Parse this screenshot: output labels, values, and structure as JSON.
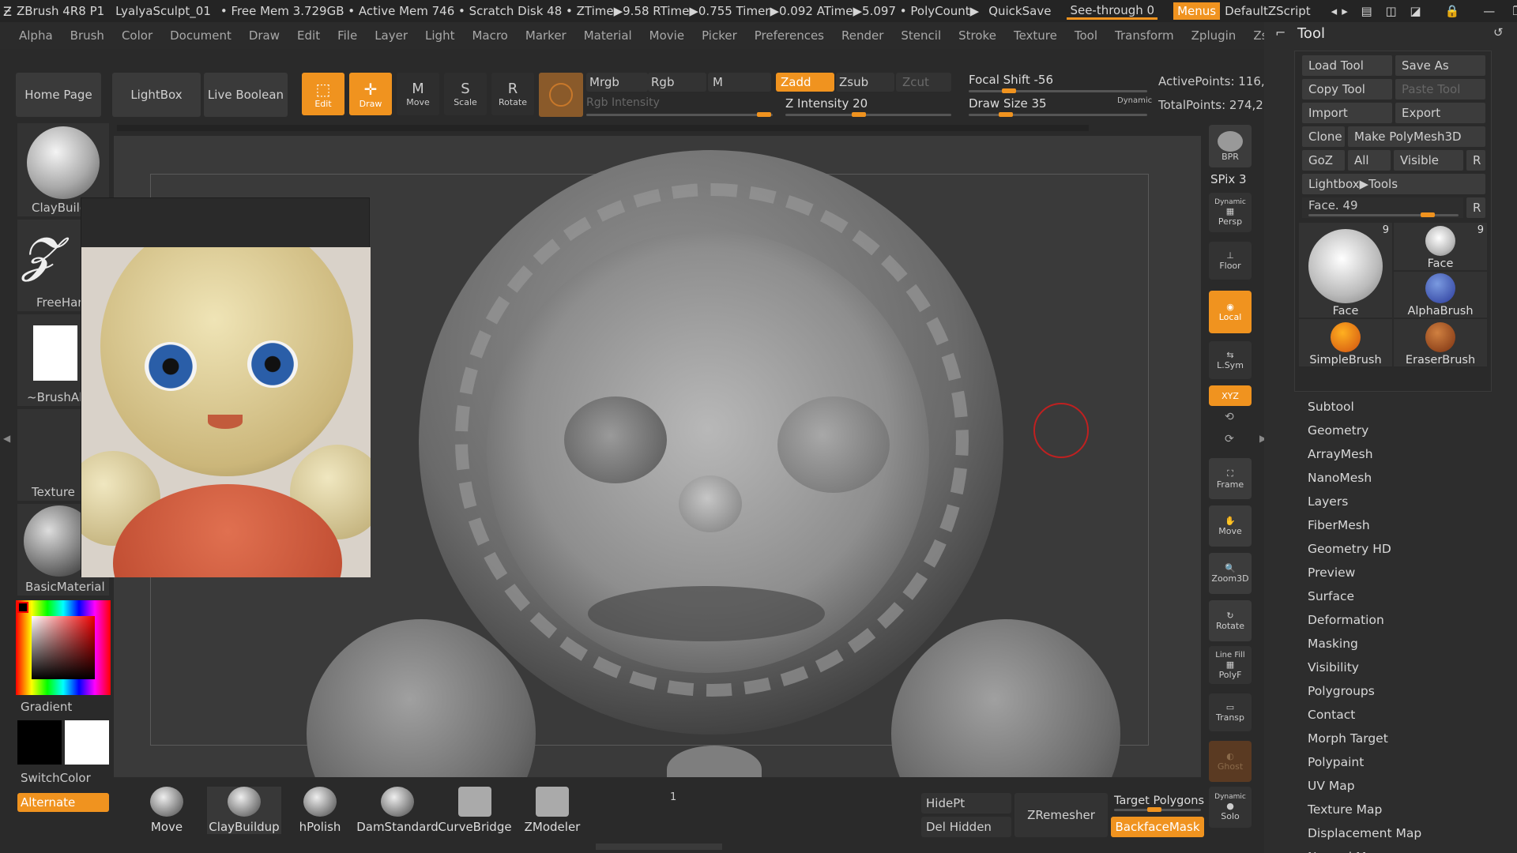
{
  "titlebar": {
    "app": "ZBrush 4R8 P1",
    "project": "LyalyaSculpt_01",
    "stats": "• Free Mem 3.729GB • Active Mem 746 • Scratch Disk 48 • ZTime▶9.58 RTime▶0.755 Timer▶0.092 ATime▶5.097 • PolyCount▶",
    "quicksave": "QuickSave",
    "seethrough": "See-through  0",
    "menus": "Menus",
    "zscript": "DefaultZScript"
  },
  "menus": [
    "Alpha",
    "Brush",
    "Color",
    "Document",
    "Draw",
    "Edit",
    "File",
    "Layer",
    "Light",
    "Macro",
    "Marker",
    "Material",
    "Movie",
    "Picker",
    "Preferences",
    "Render",
    "Stencil",
    "Stroke",
    "Texture",
    "Tool",
    "Transform",
    "Zplugin",
    "Zscript"
  ],
  "top": {
    "home": "Home Page",
    "lightbox": "LightBox",
    "liveboolean": "Live Boolean",
    "edit": "Edit",
    "draw": "Draw",
    "move": "Move",
    "scale": "Scale",
    "rotate": "Rotate",
    "mrgb": "Mrgb",
    "rgb": "Rgb",
    "m": "M",
    "zadd": "Zadd",
    "zsub": "Zsub",
    "zcut": "Zcut",
    "rgb_intensity": "Rgb Intensity",
    "z_intensity": "Z Intensity 20",
    "focal_shift": "Focal Shift -56",
    "draw_size": "Draw Size 35",
    "dynamic": "Dynamic",
    "active_points": "ActivePoints: 116,",
    "total_points": "TotalPoints: 274,2"
  },
  "left": {
    "claybuild": "ClayBuild",
    "freehand": "FreeHar",
    "brushalpha": "~BrushAl",
    "texture": "Texture",
    "material": "BasicMaterial",
    "gradient": "Gradient",
    "switchcolor": "SwitchColor",
    "alternate": "Alternate"
  },
  "right": {
    "bpr": "BPR",
    "spix": "SPix 3",
    "dynamic": "Dynamic",
    "persp": "Persp",
    "floor": "Floor",
    "local": "Local",
    "lsym": "L.Sym",
    "xyz": "XYZ",
    "frame": "Frame",
    "move": "Move",
    "zoom3d": "Zoom3D",
    "rotate": "Rotate",
    "linefill": "Line Fill",
    "polyf": "PolyF",
    "transp": "Transp",
    "ghost": "Ghost",
    "dynamic2": "Dynamic",
    "solo": "Solo"
  },
  "toolpanel": {
    "title": "Tool",
    "load": "Load Tool",
    "saveas": "Save As",
    "copy": "Copy Tool",
    "paste": "Paste Tool",
    "import": "Import",
    "export": "Export",
    "clone": "Clone",
    "makepoly": "Make PolyMesh3D",
    "goz": "GoZ",
    "all": "All",
    "visible": "Visible",
    "r": "R",
    "lightbox": "Lightbox▶Tools",
    "face_slider": "Face. 49",
    "r2": "R",
    "thumbs": [
      {
        "label": "Face",
        "count": "9"
      },
      {
        "label": "Face",
        "count": "9"
      },
      {
        "label": "AlphaBrush"
      },
      {
        "label": "SimpleBrush"
      },
      {
        "label": "EraserBrush"
      }
    ],
    "sections": [
      "Subtool",
      "Geometry",
      "ArrayMesh",
      "NanoMesh",
      "Layers",
      "FiberMesh",
      "Geometry HD",
      "Preview",
      "Surface",
      "Deformation",
      "Masking",
      "Visibility",
      "Polygroups",
      "Contact",
      "Morph Target",
      "Polypaint",
      "UV Map",
      "Texture Map",
      "Displacement Map",
      "Normal Map"
    ]
  },
  "bottom": {
    "brushes": [
      "Move",
      "ClayBuildup",
      "hPolish",
      "DamStandard",
      "CurveBridge",
      "ZModeler"
    ],
    "count": "1",
    "hidept": "HidePt",
    "delhidden": "Del Hidden",
    "zremesher": "ZRemesher",
    "target": "Target Polygons",
    "backface": "BackfaceMask"
  },
  "colors": {
    "accent": "#f0931f",
    "bg": "#2a2a2a"
  }
}
